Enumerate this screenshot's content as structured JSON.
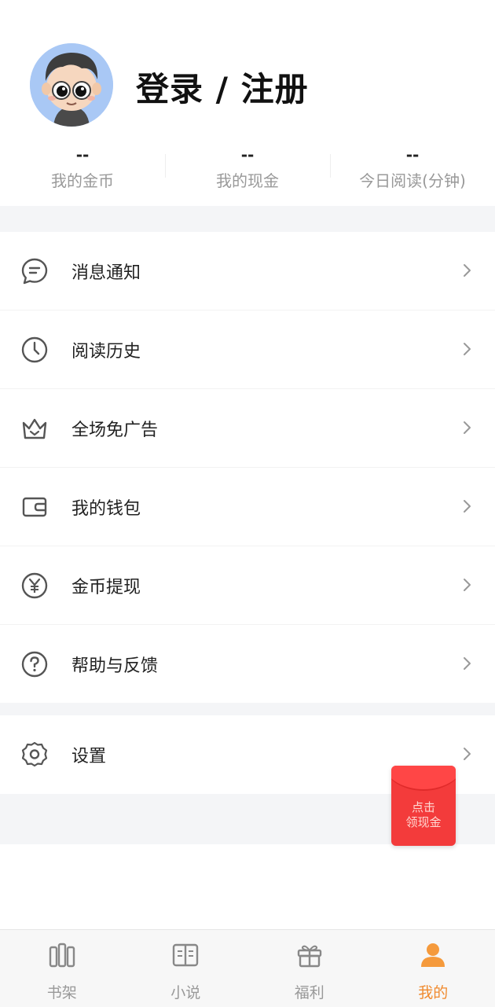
{
  "profile": {
    "login_title": "登录 / 注册"
  },
  "stats": [
    {
      "value": "--",
      "label": "我的金币"
    },
    {
      "value": "--",
      "label": "我的现金"
    },
    {
      "value": "--",
      "label": "今日阅读(分钟)"
    }
  ],
  "menu": [
    {
      "label": "消息通知",
      "icon": "message-icon"
    },
    {
      "label": "阅读历史",
      "icon": "clock-icon"
    },
    {
      "label": "全场免广告",
      "icon": "crown-icon"
    },
    {
      "label": "我的钱包",
      "icon": "wallet-icon"
    },
    {
      "label": "金币提现",
      "icon": "yen-coin-icon"
    },
    {
      "label": "帮助与反馈",
      "icon": "help-icon"
    }
  ],
  "settings": {
    "label": "设置",
    "icon": "gear-icon"
  },
  "redpacket": {
    "line1": "点击",
    "line2": "领现金"
  },
  "tabs": [
    {
      "label": "书架",
      "icon": "bookshelf-icon",
      "active": false
    },
    {
      "label": "小说",
      "icon": "book-icon",
      "active": false
    },
    {
      "label": "福利",
      "icon": "gift-icon",
      "active": false
    },
    {
      "label": "我的",
      "icon": "person-icon",
      "active": true
    }
  ],
  "colors": {
    "accent": "#f08a2e",
    "redpacket": "#f33b3b",
    "divider": "#f4f5f7",
    "muted_text": "#999999"
  }
}
